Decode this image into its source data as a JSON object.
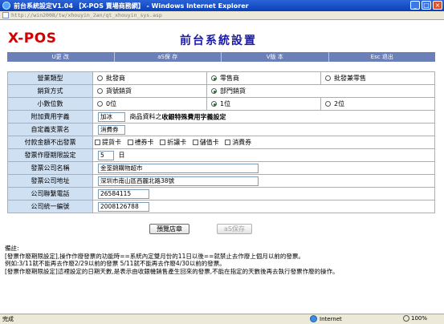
{
  "window": {
    "title": "前台系統設定V1.04 【X-POS 賣場商務網】 - Windows Internet Explorer",
    "url": "http://win2008/tw/xhouyin_2an/qt_xhouyin_sys.asp"
  },
  "app": {
    "logo": "X-POS",
    "heading": "前台系統設置"
  },
  "toolbar": {
    "items": [
      "U更 改",
      "aS保 存",
      "V版 本",
      "Esc 退出"
    ]
  },
  "form": {
    "business_type": {
      "label": "營業類型",
      "options": [
        "批發商",
        "零售商",
        "批發兼零售"
      ],
      "selected_index": 1
    },
    "sales_method": {
      "label": "銷貨方式",
      "options": [
        "貨號銷貨",
        "部門銷貨"
      ],
      "selected_index": 1
    },
    "decimal_places": {
      "label": "小數位數",
      "options": [
        "0位",
        "1位",
        "2位"
      ],
      "selected_index": 1
    },
    "surcharge": {
      "label": "附加費用字義",
      "value": "加冰",
      "description": "商品資料之",
      "description_bold": "收銀特殊費用字義設定"
    },
    "voucher_name": {
      "label": "自定義支票名",
      "value": "消費券"
    },
    "no_invoice": {
      "label": "付款金額不出發票",
      "options": [
        "提貨卡",
        "禮券卡",
        "折讓卡",
        "儲值卡",
        "消費券"
      ]
    },
    "invoice_void_days": {
      "label": "發票作廢期限設定",
      "value": "5",
      "unit": "日"
    },
    "company_name": {
      "label": "發票公司名稱",
      "value": "金筌錦購物超市"
    },
    "company_address": {
      "label": "發票公司地址",
      "value": "深圳市南山區西麗北路38號"
    },
    "company_phone": {
      "label": "公司聯繫電話",
      "value": "26584115"
    },
    "tax_id": {
      "label": "公司統一編號",
      "value": "2008126788"
    }
  },
  "actions": {
    "preview": "預覽店章",
    "save": "aS保存"
  },
  "notes": {
    "lines": [
      "備註:",
      "[發票作廢期限設定],操作作廢發票的功能時==系統內定雙月份的11日以後==就禁止去作廢上個月以前的發票。",
      "例如:3/11就不能再去作廢2/29以前的發票 5/11就不能再去作廢4/30以前的發票。",
      "[發票作廢期限設定]這裡設定的日期天數,是表示由收銀機銷售產生回來的發票,不能在指定的天數後再去執行發票作廢的操作。"
    ]
  },
  "statusbar": {
    "status": "完成",
    "zone": "Internet",
    "zoom": "100%"
  }
}
